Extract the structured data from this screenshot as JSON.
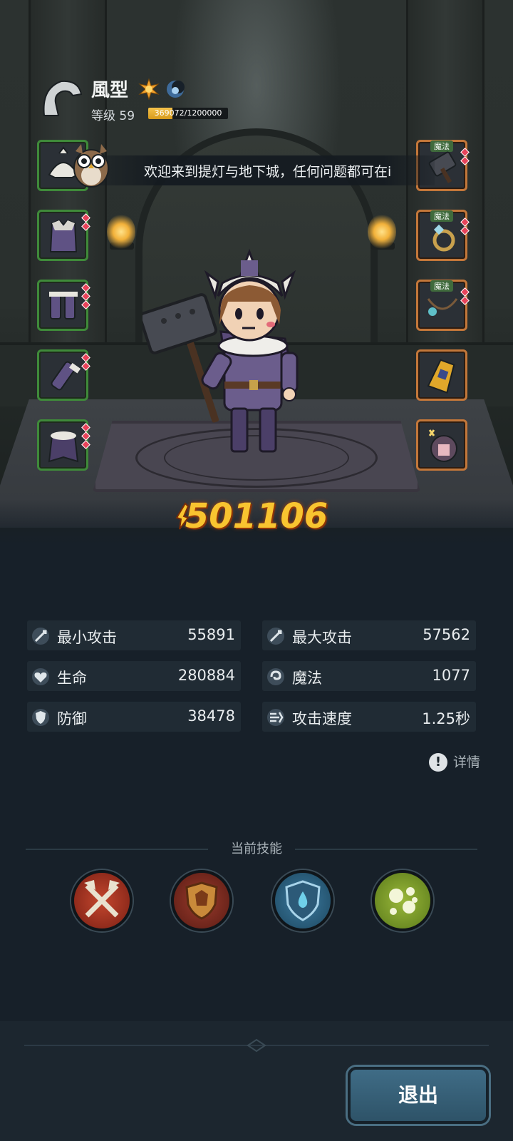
{
  "player": {
    "name": "風型",
    "level_label": "等级 59",
    "xp_text": "369072/1200000",
    "xp_fraction": 0.3076
  },
  "notice": {
    "text": "欢迎来到提灯与地下城，任何问题都可在i"
  },
  "equipment": {
    "left": [
      {
        "name": "helmet"
      },
      {
        "name": "armor"
      },
      {
        "name": "boots"
      },
      {
        "name": "gloves"
      },
      {
        "name": "cape"
      }
    ],
    "right": [
      {
        "name": "weapon",
        "tag": "魔法"
      },
      {
        "name": "ring",
        "tag": "魔法"
      },
      {
        "name": "necklace",
        "tag": "魔法"
      },
      {
        "name": "bracer"
      },
      {
        "name": "pet"
      }
    ]
  },
  "power": {
    "value": "501106"
  },
  "stats": {
    "min_attack": {
      "label": "最小攻击",
      "value": "55891"
    },
    "max_attack": {
      "label": "最大攻击",
      "value": "57562"
    },
    "hp": {
      "label": "生命",
      "value": "280884"
    },
    "magic": {
      "label": "魔法",
      "value": "1077"
    },
    "defense": {
      "label": "防御",
      "value": "38478"
    },
    "attack_speed": {
      "label": "攻击速度",
      "value": "1.25秒"
    }
  },
  "detail": {
    "label": "详情",
    "icon": "!"
  },
  "skills": {
    "title": "当前技能",
    "items": [
      {
        "name": "crossed-axes-skill"
      },
      {
        "name": "crest-shield-skill"
      },
      {
        "name": "water-shield-skill"
      },
      {
        "name": "spore-skill"
      }
    ]
  },
  "footer": {
    "exit_label": "退出"
  },
  "colors": {
    "power": "#f8c430",
    "exit_button": "#3f6c86",
    "panel": "#202b34",
    "background": "#172029"
  }
}
